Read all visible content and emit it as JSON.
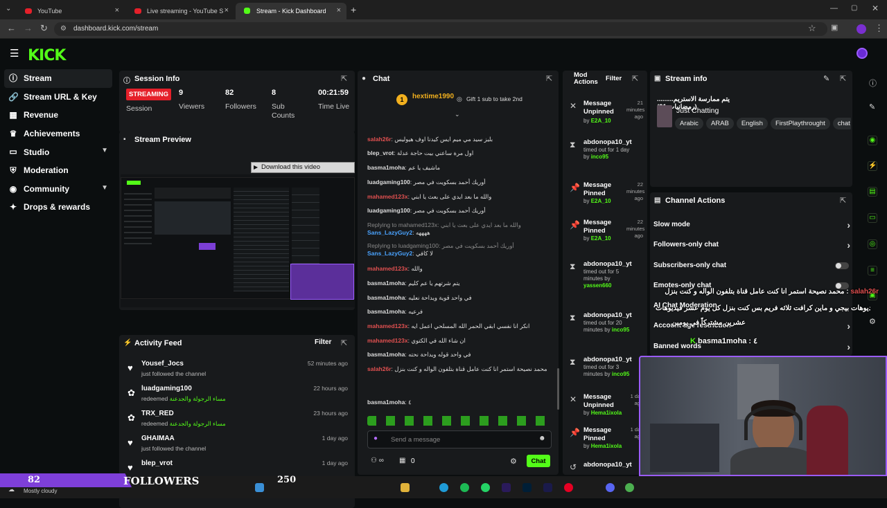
{
  "browser": {
    "tabs": [
      {
        "label": "YouTube"
      },
      {
        "label": "Live streaming - YouTube Studio"
      },
      {
        "label": "Stream - Kick Dashboard"
      }
    ],
    "url": "dashboard.kick.com/stream"
  },
  "app": {
    "logo": "KICK"
  },
  "sidebar": {
    "items": [
      {
        "label": "Stream",
        "icon": "info-icon"
      },
      {
        "label": "Stream URL & Key",
        "icon": "link-icon"
      },
      {
        "label": "Revenue",
        "icon": "revenue-icon"
      },
      {
        "label": "Achievements",
        "icon": "trophy-icon"
      },
      {
        "label": "Studio",
        "icon": "studio-icon"
      },
      {
        "label": "Moderation",
        "icon": "shield-icon"
      },
      {
        "label": "Community",
        "icon": "users-icon"
      },
      {
        "label": "Drops & rewards",
        "icon": "gift-icon"
      }
    ]
  },
  "session": {
    "title": "Session Info",
    "status": "STREAMING",
    "status_label": "Session",
    "viewers": "9",
    "viewers_label": "Viewers",
    "followers": "82",
    "followers_label": "Followers",
    "subs": "8",
    "subs_label": "Sub Counts",
    "time": "00:21:59",
    "time_label": "Time Live"
  },
  "preview": {
    "title": "Stream Preview",
    "download": "Download this video"
  },
  "activity": {
    "title": "Activity Feed",
    "filter": "Filter",
    "items": [
      {
        "name": "Yousef_Jocs",
        "action": "just followed the channel",
        "reward": "",
        "time": "52 minutes ago"
      },
      {
        "name": "luadgaming100",
        "action": "redeemed",
        "reward": "مساء الرجولة والجدعنة",
        "time": "22 hours ago"
      },
      {
        "name": "TRX_RED",
        "action": "redeemed",
        "reward": "مساء الرجولة والجدعنة",
        "time": "23 hours ago"
      },
      {
        "name": "GHAIMAA",
        "action": "just followed the channel",
        "reward": "",
        "time": "1 day ago"
      },
      {
        "name": "blep_vrot",
        "action": "",
        "reward": "",
        "time": "1 day ago"
      }
    ]
  },
  "chat": {
    "title": "Chat",
    "pinned_user": "hextime1990",
    "pinned_badge": "1",
    "gift_text": "Gift 1 sub to take 2nd",
    "messages": [
      {
        "user": "salah26r",
        "text": "بليز سيد مي ميم ايس كيدنا اوف هيوليس",
        "color": "#e05050"
      },
      {
        "user": "blep_vrot",
        "text": "اول مرة ساعني بيت حاجة عدلة",
        "color": "#ffffff"
      },
      {
        "user": "basma1moha",
        "text": "ماشيف يا عم",
        "color": "#ffffff"
      },
      {
        "user": "luadgaming100",
        "text": "أوريك أحمد بسكويت في مصر",
        "color": "#ffffff"
      },
      {
        "user": "mahamed123x",
        "text": "والله ما بعد ايدي على بعث يا ابني",
        "color": "#e05050"
      },
      {
        "user": "luadgaming100",
        "text": "أوريك أحمد بسكويت في مصر",
        "color": "#ffffff"
      },
      {
        "user": "Sans_LazyGuy2",
        "text": "ههههه",
        "color": "#4aa3ff",
        "reply": "Replying to mahamed123x: والله ما بعد ايدي على بعث يا ابني"
      },
      {
        "user": "Sans_LazyGuy2",
        "text": "لا كافي",
        "color": "#4aa3ff",
        "reply": "Replying to luadgaming100: أوريك أحمد بسكويت في مصر"
      },
      {
        "user": "mahamed123x",
        "text": "والله",
        "color": "#e05050"
      },
      {
        "user": "basma1moha",
        "text": "يتم شرتهم يا عم كليم",
        "color": "#ffffff"
      },
      {
        "user": "basma1moha",
        "text": "في واحد قوية ويداحة نعليه",
        "color": "#ffffff"
      },
      {
        "user": "basma1moha",
        "text": "فرعيه",
        "color": "#ffffff"
      },
      {
        "user": "mahamed123x",
        "text": "انكر انا نفسي ابقي الحمر الله المسلحي اعمل ايه",
        "color": "#e05050"
      },
      {
        "user": "mahamed123x",
        "text": "ان شاء الله في الكتوي",
        "color": "#e05050"
      },
      {
        "user": "basma1moha",
        "text": "في واحد قوله ويداحة نحته",
        "color": "#ffffff"
      },
      {
        "user": "salah26r",
        "text": "محمد نصيحة استمر انا كنت عامل قناة بتلفون الواله و كنت بنزل",
        "color": "#e05050"
      },
      {
        "user": "basma1moha",
        "text": "٤",
        "color": "#ffffff"
      }
    ],
    "input_placeholder": "Send a message",
    "count": "0",
    "send_label": "Chat"
  },
  "mod": {
    "title": "Mod Actions",
    "filter": "Filter",
    "items": [
      {
        "title": "Message Unpinned",
        "sub": "by",
        "user": "E2A_10",
        "time": "21 minutes ago",
        "icon": "unpin-icon"
      },
      {
        "title": "abdonopa10_yt",
        "sub": "timed out for 1 day by",
        "user": "inco95",
        "time": "",
        "icon": "hourglass-icon"
      },
      {
        "title": "Message Pinned",
        "sub": "by",
        "user": "E2A_10",
        "time": "22 minutes ago",
        "icon": "pin-icon"
      },
      {
        "title": "Message Pinned",
        "sub": "by",
        "user": "E2A_10",
        "time": "22 minutes ago",
        "icon": "pin-icon"
      },
      {
        "title": "abdonopa10_yt",
        "sub": "timed out for 5 minutes by",
        "user": "yassen660",
        "time": "",
        "icon": "hourglass-icon"
      },
      {
        "title": "abdonopa10_yt",
        "sub": "timed out for 20 minutes by",
        "user": "inco95",
        "time": "",
        "icon": "hourglass-icon"
      },
      {
        "title": "abdonopa10_yt",
        "sub": "timed out for 3 minutes by",
        "user": "inco95",
        "time": "",
        "icon": "hourglass-icon"
      },
      {
        "title": "Message Unpinned",
        "sub": "by",
        "user": "Hema1ixola",
        "time": "1 day ago",
        "icon": "unpin-icon"
      },
      {
        "title": "Message Pinned",
        "sub": "by",
        "user": "Hema1ixola",
        "time": "1 day ago",
        "icon": "pin-icon"
      },
      {
        "title": "abdonopa10_yt",
        "sub": "",
        "user": "",
        "time": "",
        "icon": "undo-icon"
      }
    ]
  },
  "stream_info": {
    "title": "Stream info",
    "stream_title": "يتم ممارسة الاستريم.........(رمضانيات 21)",
    "category": "Just Chatting",
    "tags": [
      "Arabic",
      "ARAB",
      "English",
      "FirstPlaythrought",
      "chat"
    ]
  },
  "channel_actions": {
    "title": "Channel Actions",
    "items": [
      {
        "label": "Slow mode",
        "type": "arrow"
      },
      {
        "label": "Followers-only chat",
        "type": "arrow"
      },
      {
        "label": "Subscribers-only chat",
        "type": "toggle"
      },
      {
        "label": "Emotes-only chat",
        "type": "toggle"
      },
      {
        "label": "AI Chat Moderation",
        "type": "none"
      },
      {
        "label": "Account age restriction",
        "type": "arrow"
      },
      {
        "label": "Banned words",
        "type": "arrow"
      }
    ]
  },
  "overlay": {
    "line1": "محمد نصيحة استمر انا كنت عامل قناة بتلفون الواله و كنت بنزل",
    "line1_user": "salah26r",
    "line2": "فيديوهات بيجي و ماين كرافت ثلاثه فريم بس كنت بنزل كل يوم عشر فيديوهات",
    "line3": "عشرين مشتركاً في يومين",
    "line4_user": "basma1moha",
    "line4": "٤"
  },
  "bottom_bar": {
    "followers": "82",
    "followers_label": "FOLLOWERS",
    "goal": "250",
    "weather": "Mostly cloudy"
  },
  "colors": {
    "accent": "#53fc18",
    "streaming": "#e5202a",
    "panel": "#181a1c",
    "bg": "#0b0e0f"
  }
}
